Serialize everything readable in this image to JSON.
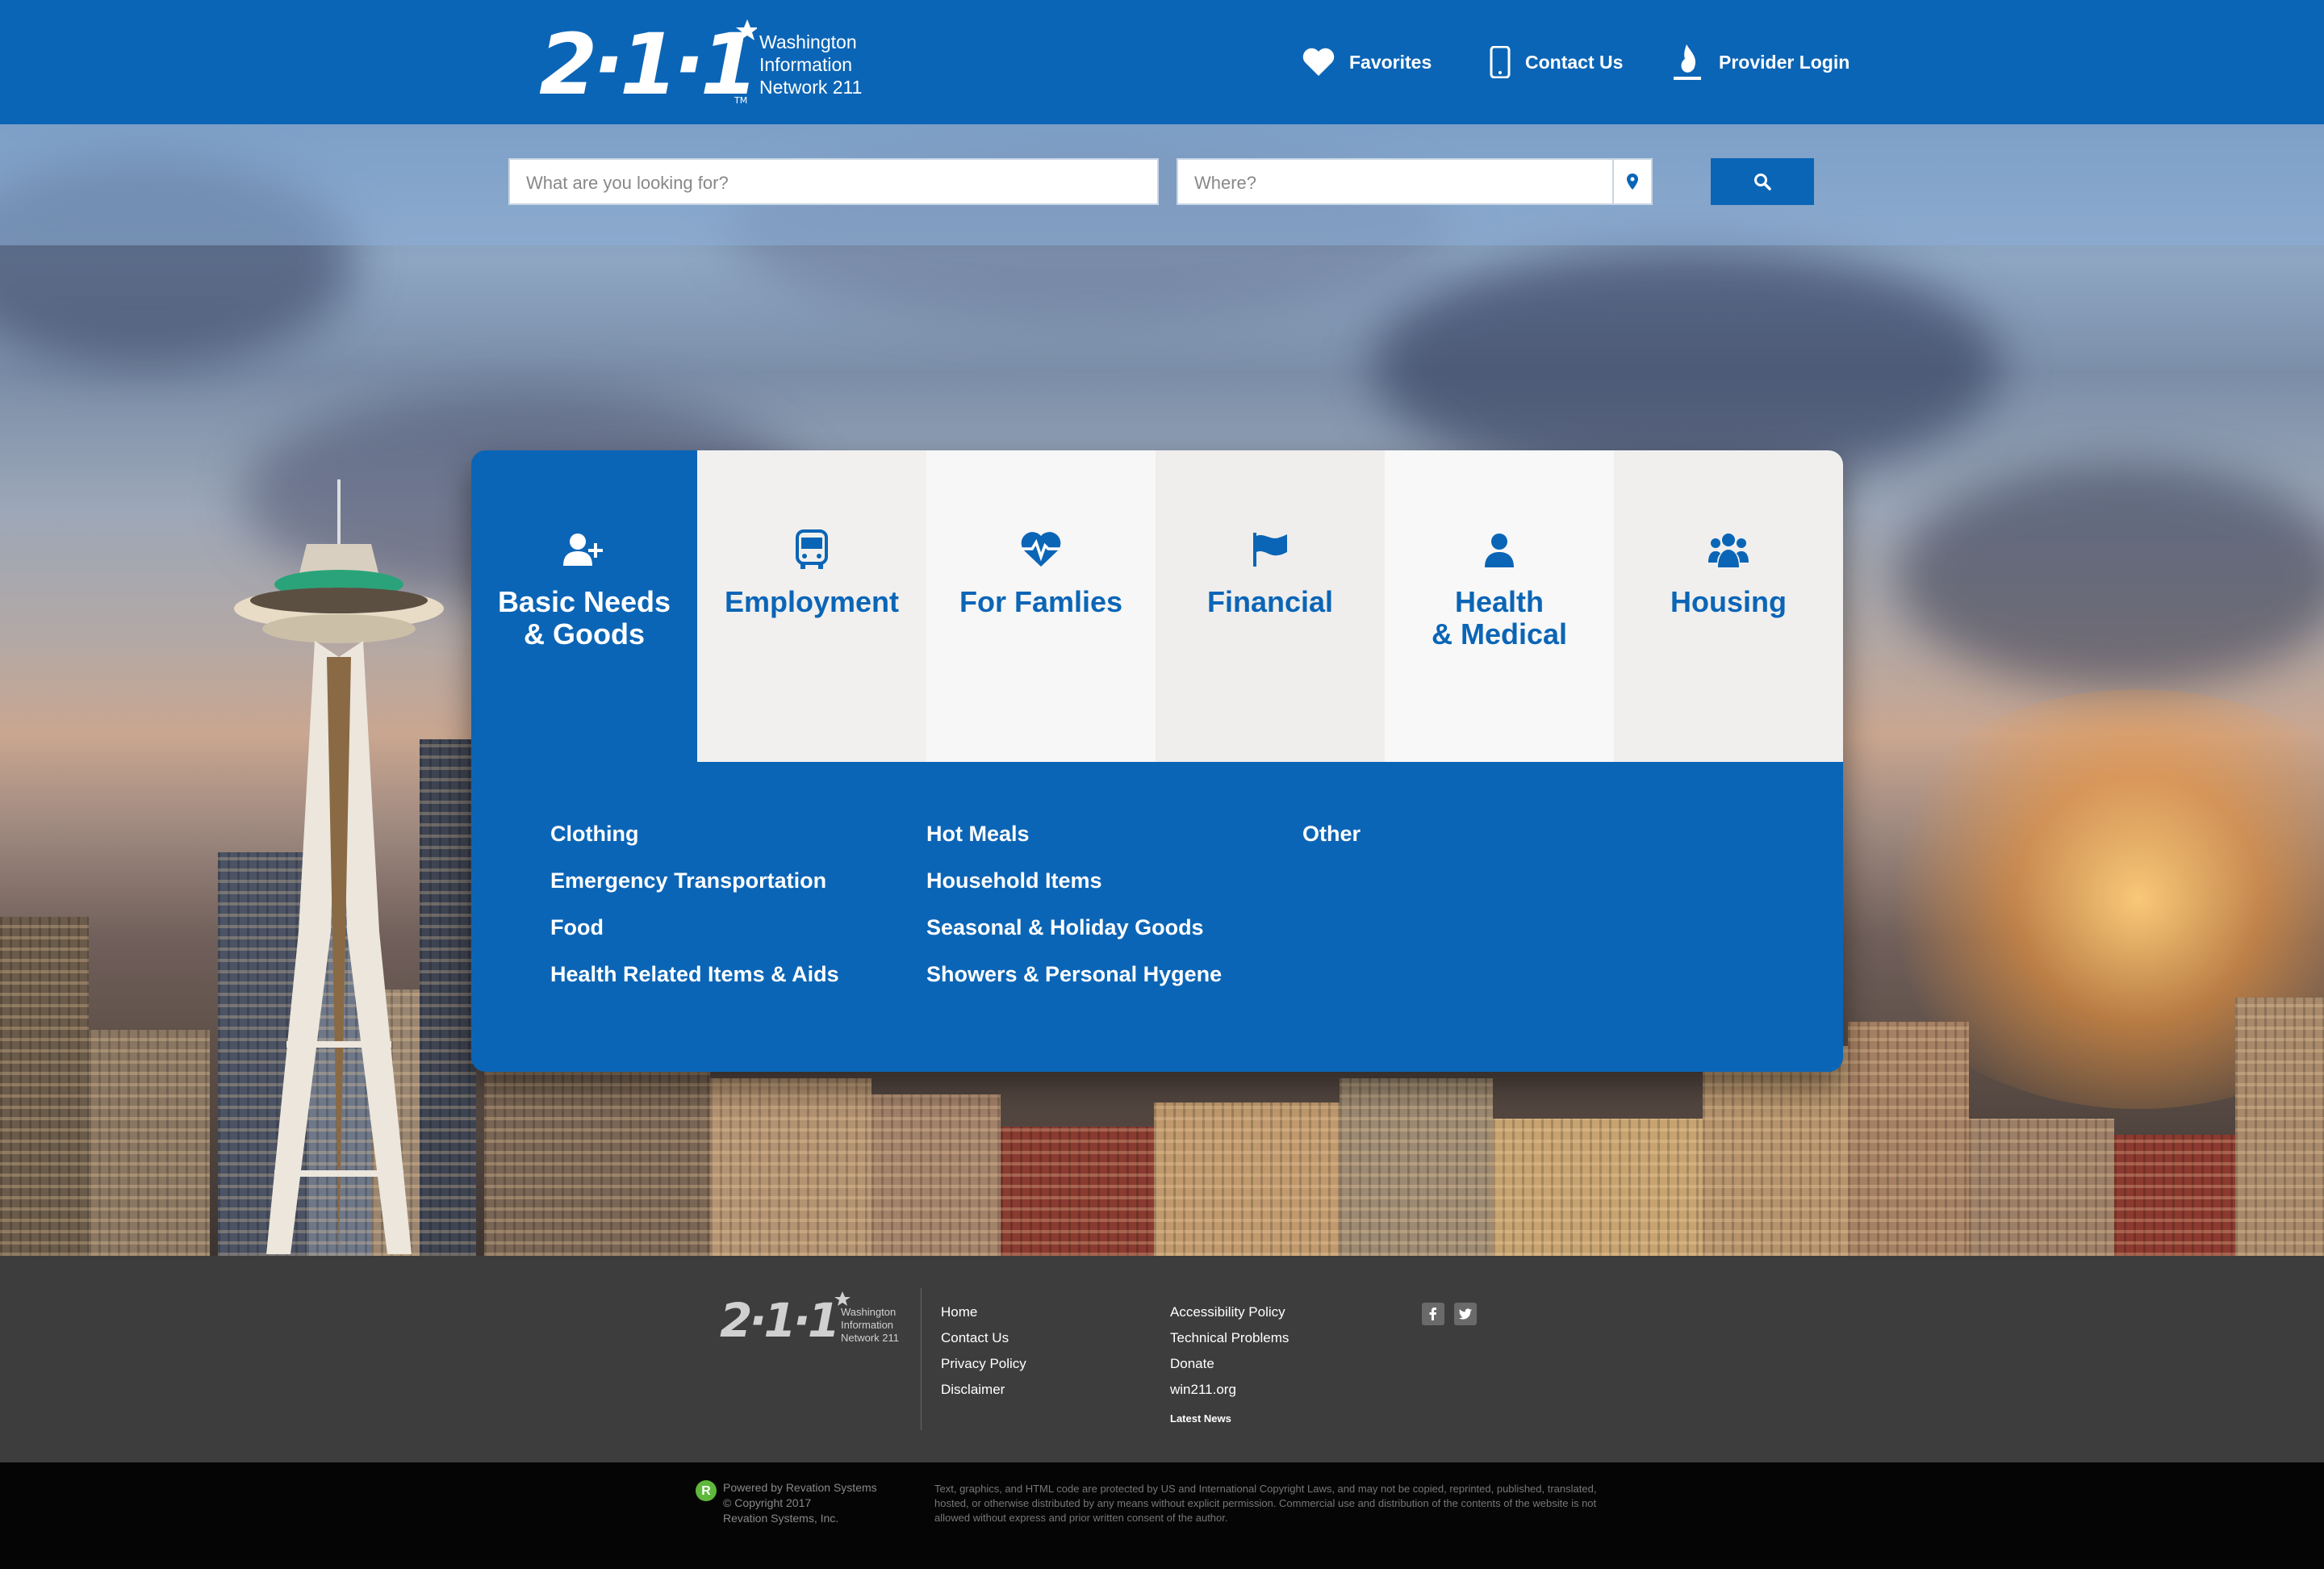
{
  "header": {
    "logo_line1": "Washington",
    "logo_line2": "Information",
    "logo_line3": "Network 211",
    "logo_numerals": "2·1·1",
    "logo_tm": "TM",
    "nav": {
      "favorites": "Favorites",
      "contact": "Contact Us",
      "provider_login": "Provider Login"
    }
  },
  "search": {
    "what_placeholder": "What are you looking for?",
    "where_placeholder": "Where?"
  },
  "categories": {
    "tabs": [
      {
        "label": "Basic Needs\n& Goods",
        "icon": "add-user-icon",
        "active": true
      },
      {
        "label": "Employment",
        "icon": "bus-icon",
        "active": false
      },
      {
        "label": "For Famlies",
        "icon": "heartbeat-icon",
        "active": false
      },
      {
        "label": "Financial",
        "icon": "flag-icon",
        "active": false
      },
      {
        "label": "Health\n& Medical",
        "icon": "user-icon",
        "active": false
      },
      {
        "label": "Housing",
        "icon": "users-icon",
        "active": false
      }
    ],
    "links_col1": [
      "Clothing",
      "Emergency Transportation",
      "Food",
      "Health Related Items & Aids"
    ],
    "links_col2": [
      "Hot Meals",
      "Household Items",
      "Seasonal & Holiday Goods",
      "Showers & Personal Hygene"
    ],
    "links_col3": [
      "Other"
    ]
  },
  "footer": {
    "col1": [
      "Home",
      "Contact Us",
      "Privacy Policy",
      "Disclaimer"
    ],
    "col2": [
      "Accessibility Policy",
      "Technical Problems",
      "Donate",
      "win211.org"
    ],
    "latest_news": "Latest News",
    "social": [
      "facebook-icon",
      "twitter-icon"
    ]
  },
  "bottom": {
    "powered": "Powered by Revation Systems",
    "copyright": "© Copyright 2017",
    "company": "Revation Systems, Inc.",
    "legal": "Text, graphics, and HTML code are protected by US and International Copyright Laws, and may not be copied, reprinted, published, translated, hosted, or otherwise distributed by any means without explicit permission. Commercial use and distribution of the contents of the website is not allowed without express and prior written consent of the author."
  },
  "colors": {
    "brand_blue": "#0b65b6",
    "footer_gray": "#3d3d3d",
    "bottom_black": "#050505"
  }
}
